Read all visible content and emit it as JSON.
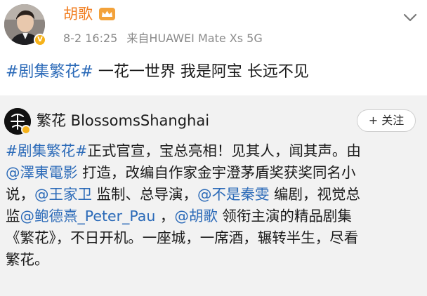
{
  "header": {
    "user_name": "胡歌",
    "timestamp": "8-2 16:25",
    "source": "来自HUAWEI Mate Xs 5G",
    "vip_badge": "V"
  },
  "post": {
    "hashtag": "#剧集繁花#",
    "text": " 一花一世界 我是阿宝 长远不见"
  },
  "repost": {
    "author_name": "繁花 BlossomsShanghai",
    "follow_label": "+ 关注",
    "body_lines": [
      [
        {
          "type": "hashtag",
          "text": "#剧集繁花#"
        },
        {
          "type": "text",
          "text": "正式官宣，宝总亮相！见其人，闻其声。由"
        }
      ],
      [
        {
          "type": "mention",
          "text": "@澤東電影"
        },
        {
          "type": "text",
          "text": " 打造，改编自作家金宇澄茅盾奖获奖同名小"
        }
      ],
      [
        {
          "type": "text",
          "text": "说，"
        },
        {
          "type": "mention",
          "text": "@王家卫"
        },
        {
          "type": "text",
          "text": " 监制、总导演，"
        },
        {
          "type": "mention",
          "text": "@不是秦雯"
        },
        {
          "type": "text",
          "text": " 编剧，视觉总"
        }
      ],
      [
        {
          "type": "text",
          "text": "监"
        },
        {
          "type": "mention",
          "text": "@鲍德熹_Peter_Pau"
        },
        {
          "type": "text",
          "text": " ，"
        },
        {
          "type": "mention",
          "text": "@胡歌"
        },
        {
          "type": "text",
          "text": " 领衔主演的精品剧集"
        }
      ],
      [
        {
          "type": "text",
          "text": "《繁花》，不日开机。一座城，一席酒，辗转半生，尽看"
        }
      ],
      [
        {
          "type": "text",
          "text": "繁花。"
        }
      ]
    ]
  },
  "icons": {
    "crown": "crown-icon",
    "dropdown": "chevron-down-icon",
    "avatar": "avatar-photo",
    "repost_avatar": "blossoms-logo"
  },
  "colors": {
    "link": "#2b6ab8",
    "name_orange": "#f17d1f",
    "meta_gray": "#8a8a8a",
    "card_bg": "#f2f2f2",
    "vip_gold": "#f6b21a"
  }
}
